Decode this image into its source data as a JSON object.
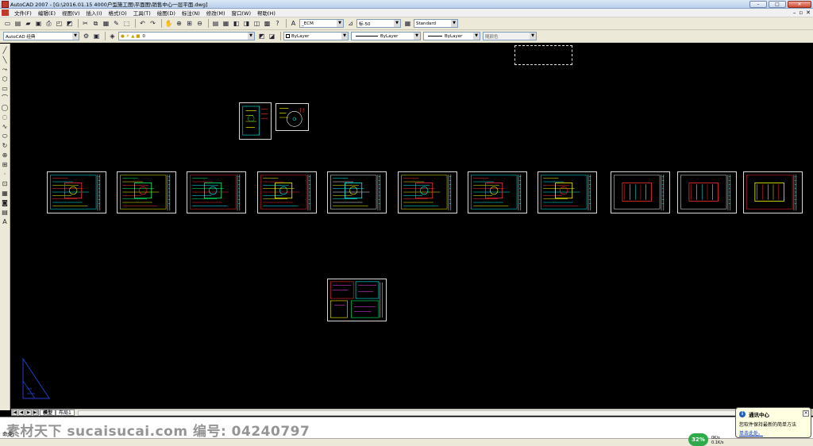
{
  "window": {
    "title": "AutoCAD 2007 - [G:\\2016.01.15  4000户型施工图\\平面图\\销售中心一层平面.dwg]",
    "controls": [
      "–",
      "□",
      "✕"
    ]
  },
  "menubar": {
    "items": [
      "文件(F)",
      "编辑(E)",
      "视图(V)",
      "插入(I)",
      "格式(O)",
      "工具(T)",
      "绘图(D)",
      "标注(N)",
      "修改(M)",
      "窗口(W)",
      "帮助(H)"
    ],
    "right": [
      "–",
      "▫",
      "✕"
    ]
  },
  "toolbar1": {
    "text_style": "_ECM",
    "dim_style": "标-50",
    "table_style": "Standard"
  },
  "toolbar2": {
    "workspace": "AutoCAD 经典",
    "layer": "0",
    "color": "ByLayer",
    "linetype": "ByLayer",
    "lineweight": "ByLayer",
    "plotstyle": "随颜色"
  },
  "left_tools": [
    "╱",
    "╲",
    "⤳",
    "⬡",
    "▭",
    "⌒",
    "◯",
    "◌",
    "∿",
    "⬭",
    "↻",
    "⊕",
    "⊞",
    "·",
    "⊡",
    "▦",
    "◙",
    "▤",
    "A"
  ],
  "layout_tabs": {
    "nav": [
      "|◀",
      "◀",
      "▶",
      "▶|"
    ],
    "tabs": [
      "模型",
      "布局1"
    ]
  },
  "command": {
    "prompt": "命令:"
  },
  "balloon": {
    "title": "通讯中心",
    "message": "您软件保持最新的简单方法",
    "link": "单击此处。"
  },
  "status": {
    "progress": "32%",
    "net_up": "0K/s",
    "net_down": "0.1K/s"
  },
  "watermark": "素材天下 sucaisucai.com  编号: 04240797",
  "colors": {
    "canvas": "#000000",
    "sheet_border": "#d8d8d8",
    "cad_cyan": "#00ffff",
    "cad_yellow": "#ffff00",
    "cad_red": "#ff3030",
    "cad_green": "#00ff66",
    "cad_magenta": "#ff44ff"
  }
}
